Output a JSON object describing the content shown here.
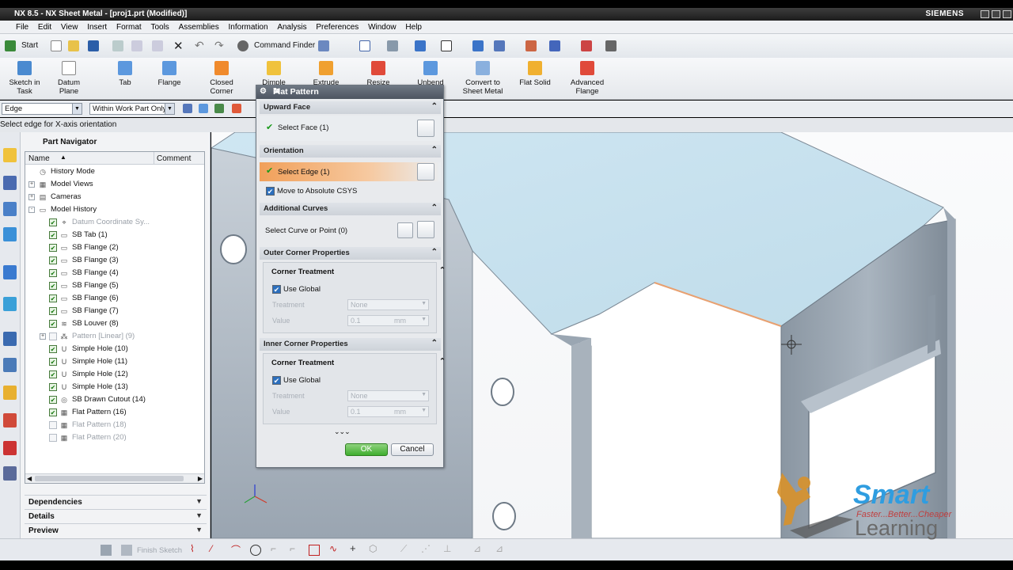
{
  "window": {
    "title": "NX 8.5 - NX Sheet Metal - [proj1.prt (Modified)]",
    "brand": "SIEMENS"
  },
  "menu": [
    "File",
    "Edit",
    "View",
    "Insert",
    "Format",
    "Tools",
    "Assemblies",
    "Information",
    "Analysis",
    "Preferences",
    "Window",
    "Help"
  ],
  "toolbar": {
    "start_label": "Start",
    "command_finder_label": "Command Finder"
  },
  "ribbon": [
    {
      "label": "Sketch in Task",
      "icon": "sketch-icon"
    },
    {
      "label": "Datum Plane",
      "icon": "datum-plane-icon"
    },
    {
      "label": "Tab",
      "icon": "tab-icon"
    },
    {
      "label": "Flange",
      "icon": "flange-icon"
    },
    {
      "label": "Closed Corner",
      "icon": "closed-corner-icon"
    },
    {
      "label": "Dimple",
      "icon": "dimple-icon"
    },
    {
      "label": "Extrude",
      "icon": "extrude-icon"
    },
    {
      "label": "Resize",
      "icon": "resize-icon"
    },
    {
      "label": "Unbend",
      "icon": "unbend-icon"
    },
    {
      "label": "Convert to Sheet Metal",
      "icon": "convert-icon"
    },
    {
      "label": "Flat Solid",
      "icon": "flat-solid-icon"
    },
    {
      "label": "Advanced Flange",
      "icon": "advanced-flange-icon"
    }
  ],
  "selection_bar": {
    "filter": "Edge",
    "scope": "Within Work Part Only"
  },
  "cue_line": "Select edge for X-axis orientation",
  "navigator": {
    "title": "Part Navigator",
    "col_name": "Name",
    "col_comment": "Comment",
    "rows": [
      {
        "label": "History Mode",
        "indent": 0,
        "icon": "clock-icon",
        "check": false,
        "dim": false,
        "exp": ""
      },
      {
        "label": "Model Views",
        "indent": 0,
        "icon": "views-icon",
        "check": false,
        "dim": false,
        "exp": "+"
      },
      {
        "label": "Cameras",
        "indent": 0,
        "icon": "camera-icon",
        "check": false,
        "dim": false,
        "exp": "+"
      },
      {
        "label": "Model History",
        "indent": 0,
        "icon": "folder-icon",
        "check": false,
        "dim": false,
        "exp": "-"
      },
      {
        "label": "Datum Coordinate Sy...",
        "indent": 1,
        "icon": "csys-icon",
        "check": true,
        "dim": true,
        "exp": ""
      },
      {
        "label": "SB Tab (1)",
        "indent": 1,
        "icon": "tab-feature-icon",
        "check": true,
        "dim": false,
        "exp": ""
      },
      {
        "label": "SB Flange (2)",
        "indent": 1,
        "icon": "flange-feature-icon",
        "check": true,
        "dim": false,
        "exp": ""
      },
      {
        "label": "SB Flange (3)",
        "indent": 1,
        "icon": "flange-feature-icon",
        "check": true,
        "dim": false,
        "exp": ""
      },
      {
        "label": "SB Flange (4)",
        "indent": 1,
        "icon": "flange-feature-icon",
        "check": true,
        "dim": false,
        "exp": ""
      },
      {
        "label": "SB Flange (5)",
        "indent": 1,
        "icon": "flange-feature-icon",
        "check": true,
        "dim": false,
        "exp": ""
      },
      {
        "label": "SB Flange (6)",
        "indent": 1,
        "icon": "flange-feature-icon",
        "check": true,
        "dim": false,
        "exp": ""
      },
      {
        "label": "SB Flange (7)",
        "indent": 1,
        "icon": "flange-feature-icon",
        "check": true,
        "dim": false,
        "exp": ""
      },
      {
        "label": "SB Louver (8)",
        "indent": 1,
        "icon": "louver-icon",
        "check": true,
        "dim": false,
        "exp": ""
      },
      {
        "label": "Pattern [Linear] (9)",
        "indent": 1,
        "icon": "pattern-icon",
        "check": false,
        "dim": true,
        "exp": "+"
      },
      {
        "label": "Simple Hole (10)",
        "indent": 1,
        "icon": "hole-icon",
        "check": true,
        "dim": false,
        "exp": ""
      },
      {
        "label": "Simple Hole (11)",
        "indent": 1,
        "icon": "hole-icon",
        "check": true,
        "dim": false,
        "exp": ""
      },
      {
        "label": "Simple Hole (12)",
        "indent": 1,
        "icon": "hole-icon",
        "check": true,
        "dim": false,
        "exp": ""
      },
      {
        "label": "Simple Hole (13)",
        "indent": 1,
        "icon": "hole-icon",
        "check": true,
        "dim": false,
        "exp": ""
      },
      {
        "label": "SB Drawn Cutout (14)",
        "indent": 1,
        "icon": "cutout-icon",
        "check": true,
        "dim": false,
        "exp": ""
      },
      {
        "label": "Flat Pattern (16)",
        "indent": 1,
        "icon": "flat-pattern-icon",
        "check": true,
        "dim": false,
        "exp": ""
      },
      {
        "label": "Flat Pattern (18)",
        "indent": 1,
        "icon": "flat-pattern-icon",
        "check": false,
        "dim": true,
        "exp": ""
      },
      {
        "label": "Flat Pattern (20)",
        "indent": 1,
        "icon": "flat-pattern-icon",
        "check": false,
        "dim": true,
        "exp": ""
      }
    ],
    "sections": [
      "Dependencies",
      "Details",
      "Preview"
    ]
  },
  "dialog": {
    "title": "Flat Pattern",
    "upward_face": {
      "header": "Upward Face",
      "label": "Select Face (1)"
    },
    "orientation": {
      "header": "Orientation",
      "label": "Select Edge (1)",
      "move_csys": "Move to Absolute CSYS"
    },
    "additional": {
      "header": "Additional Curves",
      "label": "Select Curve or Point (0)"
    },
    "outer": {
      "header": "Outer Corner Properties",
      "sub": "Corner Treatment",
      "use_global": "Use Global",
      "treatment_label": "Treatment",
      "treatment_value": "None",
      "value_label": "Value",
      "value": "0.1",
      "unit": "mm"
    },
    "inner": {
      "header": "Inner Corner Properties",
      "sub": "Corner Treatment",
      "use_global": "Use Global",
      "treatment_label": "Treatment",
      "treatment_value": "None",
      "value_label": "Value",
      "value": "0.1",
      "unit": "mm"
    },
    "ok": "OK",
    "cancel": "Cancel"
  },
  "bottom_toolbar": {
    "finish_sketch": "Finish Sketch"
  },
  "logo": {
    "title": "Smart",
    "tagline": "Faster...Better...Cheaper",
    "subtitle": "Learning"
  },
  "colors": {
    "accent_orange": "#f1a05a",
    "check_green": "#1a9a1a",
    "ok_green": "#3fae2e",
    "brand": "#2f9de0"
  }
}
